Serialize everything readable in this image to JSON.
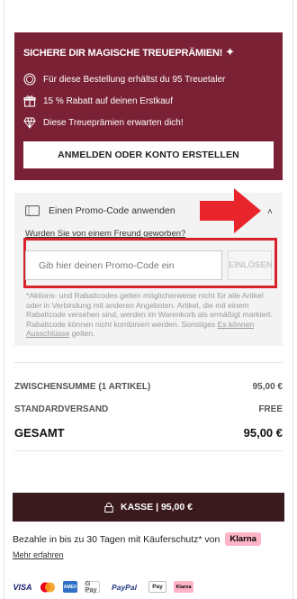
{
  "rewards": {
    "title": "SICHERE DIR MAGISCHE TREUEPRÄMIEN!",
    "perks": [
      {
        "icon": "coin-icon",
        "text": "Für diese Bestellung erhältst du 95 Treuetaler"
      },
      {
        "icon": "gift-icon",
        "text": "15 % Rabatt auf deinen Erstkauf"
      },
      {
        "icon": "diamond-icon",
        "text": "Diese Treueprämien erwarten dich!"
      }
    ],
    "button_label": "ANMELDEN ODER KONTO ERSTELLEN"
  },
  "promo": {
    "title": "Einen Promo-Code anwenden",
    "friend_link": "Wurden Sie von einem Freund geworben?",
    "input_placeholder": "Gib hier deinen Promo-Code ein",
    "apply_label": "EINLÖSEN",
    "disclaimer_text": "*Aktions- und Rabattcodes gelten möglicherweise nicht für alle Artikel oder in Verbindung mit anderen Angeboten. Artikel, die mit einem Rabattcode versehen sind, werden im Warenkorb als ermäßigt markiert. Rabattcode können nicht kombiniert werden. Sonstiges",
    "disclaimer_link": "Es können Ausschlüsse",
    "disclaimer_end": "gelten."
  },
  "summary": {
    "subtotal_label": "ZWISCHENSUMME (1 ARTIKEL)",
    "subtotal_value": "95,00 €",
    "shipping_label": "STANDARDVERSAND",
    "shipping_value": "FREE",
    "total_label": "GESAMT",
    "total_value": "95,00 €"
  },
  "checkout": {
    "label": "KASSE | 95,00 €"
  },
  "klarna": {
    "text": "Bezahle in bis zu 30 Tagen mit Käuferschutz* von",
    "badge": "Klarna",
    "more_link": "Mehr erfahren"
  },
  "payments": {
    "visa": "VISA",
    "amex": "AMEX",
    "gpay": "G Pay",
    "paypal": "PayPal",
    "apay": " Pay",
    "klarna": "Klarna"
  },
  "colors": {
    "brand": "#7a2135",
    "checkout": "#3a1a1d",
    "highlight": "#d8232a",
    "klarna": "#ffb3c7"
  }
}
